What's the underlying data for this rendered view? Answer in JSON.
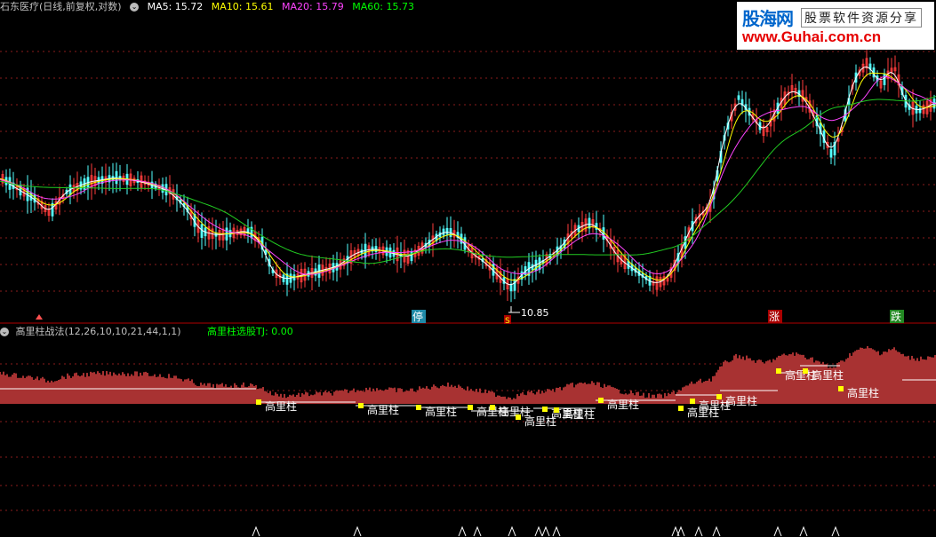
{
  "header": {
    "stock_title": "石东医疗(日线,前复权,对数)",
    "ma5": "MA5: 15.72",
    "ma10": "MA10: 15.61",
    "ma20": "MA20: 15.79",
    "ma60": "MA60: 15.73",
    "colors": {
      "ma5": "#ffffff",
      "ma10": "#ffff00",
      "ma20": "#ff44ff",
      "ma60": "#00ff00"
    }
  },
  "markers": {
    "stop_label": "停",
    "low_price_label": "10.85",
    "s_label": "S",
    "up_label": "涨",
    "down_label": "跌"
  },
  "indicator": {
    "title": "高里柱战法(12,26,10,10,21,44,1,1)",
    "select_text": "高里柱选股TJ: 0.00",
    "pillar_label": "高里柱"
  },
  "watermark": {
    "name": "股海网",
    "slogan": "股票软件资源分享",
    "url": "www.Guhai.com.cn"
  }
}
